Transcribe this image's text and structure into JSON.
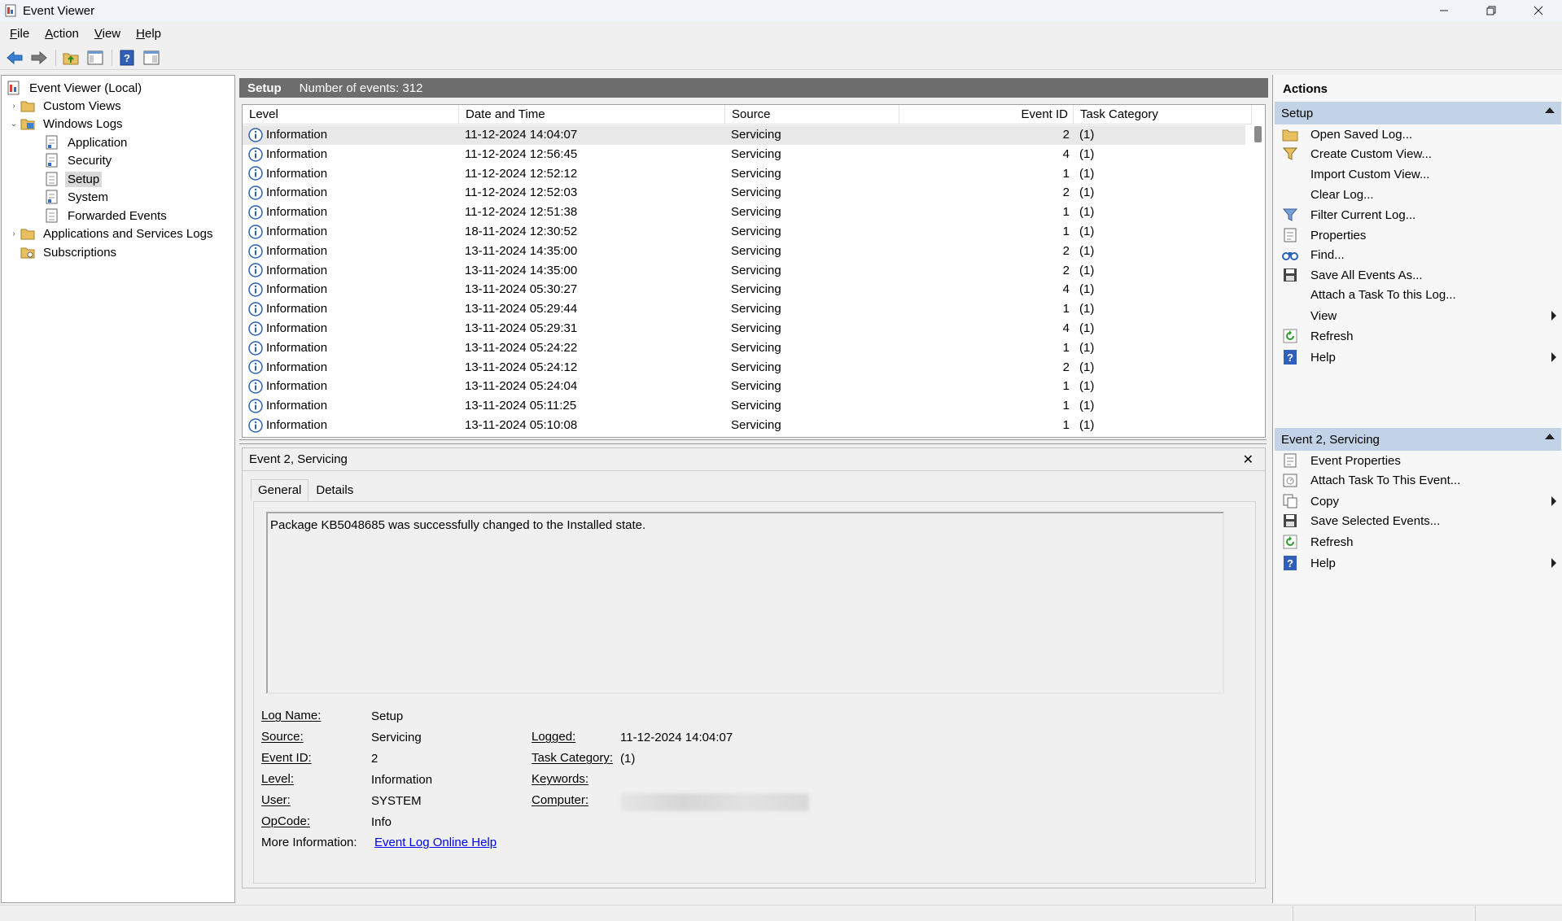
{
  "window": {
    "title": "Event Viewer"
  },
  "menu": [
    "File",
    "Action",
    "View",
    "Help"
  ],
  "tree": {
    "root": "Event Viewer (Local)",
    "custom_views": "Custom Views",
    "windows_logs": "Windows Logs",
    "application": "Application",
    "security": "Security",
    "setup": "Setup",
    "system": "System",
    "forwarded": "Forwarded Events",
    "apps_services": "Applications and Services Logs",
    "subscriptions": "Subscriptions"
  },
  "log": {
    "name": "Setup",
    "count_text": "Number of events: 312"
  },
  "table": {
    "columns": [
      "Level",
      "Date and Time",
      "Source",
      "Event ID",
      "Task Category"
    ],
    "rows": [
      {
        "level": "Information",
        "datetime": "11-12-2024 14:04:07",
        "source": "Servicing",
        "event_id": "2",
        "task": "(1)"
      },
      {
        "level": "Information",
        "datetime": "11-12-2024 12:56:45",
        "source": "Servicing",
        "event_id": "4",
        "task": "(1)"
      },
      {
        "level": "Information",
        "datetime": "11-12-2024 12:52:12",
        "source": "Servicing",
        "event_id": "1",
        "task": "(1)"
      },
      {
        "level": "Information",
        "datetime": "11-12-2024 12:52:03",
        "source": "Servicing",
        "event_id": "2",
        "task": "(1)"
      },
      {
        "level": "Information",
        "datetime": "11-12-2024 12:51:38",
        "source": "Servicing",
        "event_id": "1",
        "task": "(1)"
      },
      {
        "level": "Information",
        "datetime": "18-11-2024 12:30:52",
        "source": "Servicing",
        "event_id": "1",
        "task": "(1)"
      },
      {
        "level": "Information",
        "datetime": "13-11-2024 14:35:00",
        "source": "Servicing",
        "event_id": "2",
        "task": "(1)"
      },
      {
        "level": "Information",
        "datetime": "13-11-2024 14:35:00",
        "source": "Servicing",
        "event_id": "2",
        "task": "(1)"
      },
      {
        "level": "Information",
        "datetime": "13-11-2024 05:30:27",
        "source": "Servicing",
        "event_id": "4",
        "task": "(1)"
      },
      {
        "level": "Information",
        "datetime": "13-11-2024 05:29:44",
        "source": "Servicing",
        "event_id": "1",
        "task": "(1)"
      },
      {
        "level": "Information",
        "datetime": "13-11-2024 05:29:31",
        "source": "Servicing",
        "event_id": "4",
        "task": "(1)"
      },
      {
        "level": "Information",
        "datetime": "13-11-2024 05:24:22",
        "source": "Servicing",
        "event_id": "1",
        "task": "(1)"
      },
      {
        "level": "Information",
        "datetime": "13-11-2024 05:24:12",
        "source": "Servicing",
        "event_id": "2",
        "task": "(1)"
      },
      {
        "level": "Information",
        "datetime": "13-11-2024 05:24:04",
        "source": "Servicing",
        "event_id": "1",
        "task": "(1)"
      },
      {
        "level": "Information",
        "datetime": "13-11-2024 05:11:25",
        "source": "Servicing",
        "event_id": "1",
        "task": "(1)"
      },
      {
        "level": "Information",
        "datetime": "13-11-2024 05:10:08",
        "source": "Servicing",
        "event_id": "1",
        "task": "(1)"
      }
    ]
  },
  "detail": {
    "title": "Event 2, Servicing",
    "tabs": [
      "General",
      "Details"
    ],
    "description": "Package KB5048685 was successfully changed to the Installed state.",
    "labels": {
      "log_name": "Log Name:",
      "source": "Source:",
      "event_id": "Event ID:",
      "level": "Level:",
      "user": "User:",
      "opcode": "OpCode:",
      "more_info": "More Information:",
      "logged": "Logged:",
      "task_category": "Task Category:",
      "keywords": "Keywords:",
      "computer": "Computer:"
    },
    "values": {
      "log_name": "Setup",
      "source": "Servicing",
      "event_id": "2",
      "level": "Information",
      "user": "SYSTEM",
      "opcode": "Info",
      "logged": "11-12-2024 14:04:07",
      "task_category": "(1)",
      "more_info_link": "Event Log Online Help"
    }
  },
  "actions": {
    "title": "Actions",
    "section1": "Setup",
    "section1_items": [
      "Open Saved Log...",
      "Create Custom View...",
      "Import Custom View...",
      "Clear Log...",
      "Filter Current Log...",
      "Properties",
      "Find...",
      "Save All Events As...",
      "Attach a Task To this Log...",
      "View",
      "Refresh",
      "Help"
    ],
    "section2": "Event 2, Servicing",
    "section2_items": [
      "Event Properties",
      "Attach Task To This Event...",
      "Copy",
      "Save Selected Events...",
      "Refresh",
      "Help"
    ]
  },
  "colors": {
    "section_header": "#c3d3e7",
    "log_header": "#6d6d6d",
    "link": "#0000ee",
    "info_icon": "#2a62b8"
  }
}
